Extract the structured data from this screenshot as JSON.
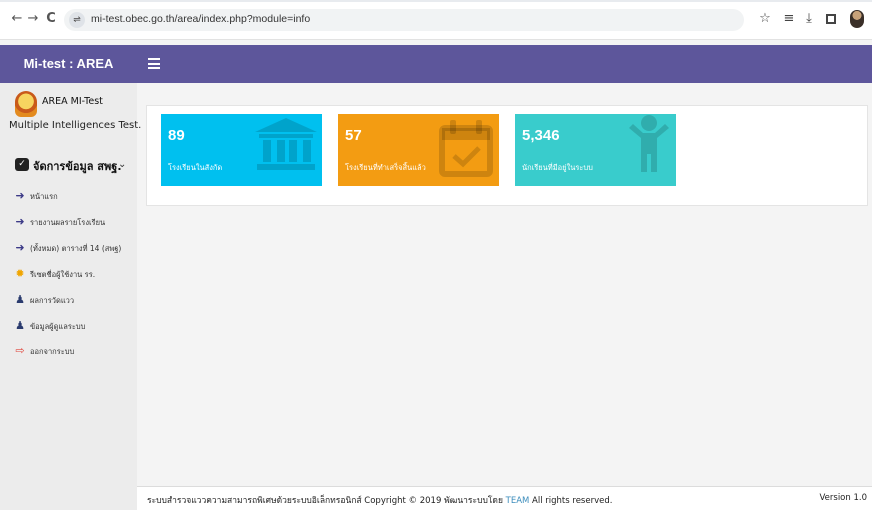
{
  "browser": {
    "url": "mi-test.obec.go.th/area/index.php?module=info",
    "back_icon": "←",
    "forward_icon": "→",
    "reload_icon": "C",
    "site_info_icon": "⇌",
    "star_icon": "☆",
    "queue_icon": "≡",
    "download_icon": "⤓"
  },
  "sidebar": {
    "brand": "Mi-test : AREA",
    "user_name": "AREA MI-Test",
    "user_subtitle": "Multiple Intelligences Test.",
    "menu_header": {
      "label": "จัดการข้อมูล สพฐ.",
      "chevron": "⌄"
    },
    "items": [
      {
        "label": "หน้าแรก",
        "icon": "arrow-right-icon",
        "glyph": "➜",
        "color": "#3c3a87"
      },
      {
        "label": "รายงานผลรายโรงเรียน",
        "icon": "arrow-right-icon",
        "glyph": "➜",
        "color": "#3c3a87"
      },
      {
        "label": "(ทั้งหมด) ตารางที่ 14 (สพฐ)",
        "icon": "arrow-right-icon",
        "glyph": "➜",
        "color": "#3c3a87"
      },
      {
        "label": "รีเซตชื่อผู้ใช้งาน รร.",
        "icon": "gear-icon",
        "glyph": "✹",
        "color": "#f0a500"
      },
      {
        "label": "ผลการวัดแวว",
        "icon": "user-icon",
        "glyph": "♟",
        "color": "#2a3b6e"
      },
      {
        "label": "ข้อมูลผู้ดูแลระบบ",
        "icon": "user-icon",
        "glyph": "♟",
        "color": "#2a3b6e"
      },
      {
        "label": "ออกจากระบบ",
        "icon": "sign-out-icon",
        "glyph": "⇨",
        "color": "#e0463c"
      }
    ]
  },
  "stats": [
    {
      "number": "89",
      "label": "โรงเรียนในสังกัด",
      "color": "#00c0ef",
      "icon": "institution-icon"
    },
    {
      "number": "57",
      "label": "โรงเรียนที่ทำเสร็จสิ้นแล้ว",
      "color": "#f39c12",
      "icon": "calendar-check-icon"
    },
    {
      "number": "5,346",
      "label": "นักเรียนที่มีอยู่ในระบบ",
      "color": "#39cccc",
      "icon": "child-icon"
    }
  ],
  "footer": {
    "text_before": "ระบบสำรวจแววความสามารถพิเศษด้วยระบบอิเล็กทรอนิกส์ Copyright © 2019 พัฒนาระบบโดย ",
    "team_link": "TEAM",
    "text_after": " All rights reserved.",
    "version": "Version 1.0"
  },
  "colors": {
    "navbar": "#5d569b",
    "sidebar": "#ececec",
    "link": "#3c8dbc"
  }
}
